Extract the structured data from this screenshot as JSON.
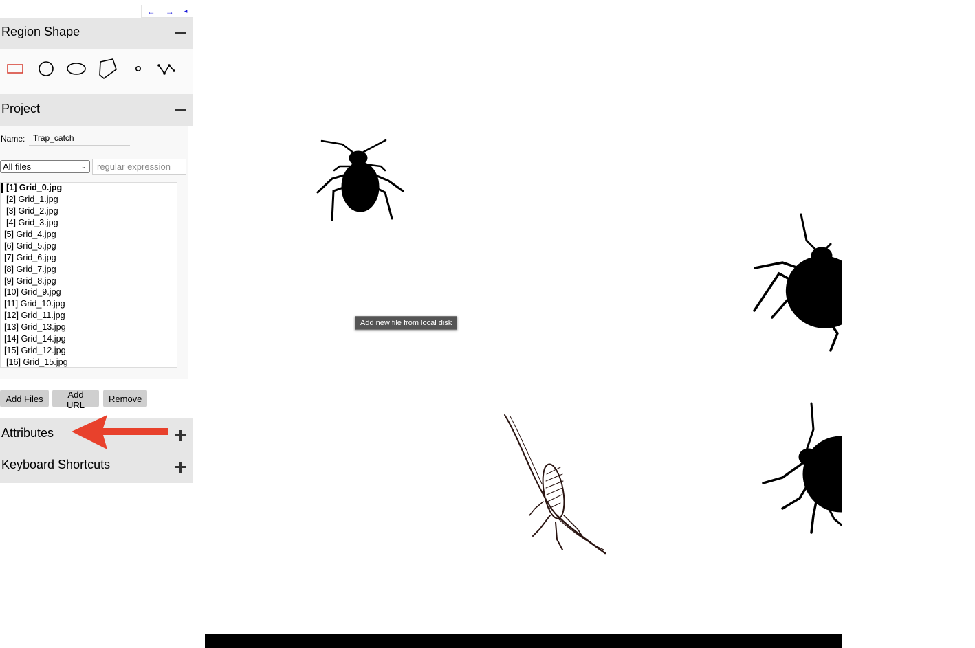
{
  "nav": {
    "prev": "←",
    "next": "→",
    "collapse": "◂"
  },
  "region_shape": {
    "title": "Region Shape",
    "shapes": [
      {
        "name": "rectangle",
        "icon": "rectangle-icon",
        "selected": true
      },
      {
        "name": "circle",
        "icon": "circle-icon"
      },
      {
        "name": "ellipse",
        "icon": "ellipse-icon"
      },
      {
        "name": "polygon",
        "icon": "polygon-icon"
      },
      {
        "name": "point",
        "icon": "point-icon"
      },
      {
        "name": "polyline",
        "icon": "polyline-icon"
      }
    ],
    "selected_color": "#d53a2c"
  },
  "project": {
    "title": "Project",
    "name_label": "Name:",
    "name_value": "Trap_catch",
    "filter_selected": "All files",
    "regex_placeholder": "regular expression",
    "files": [
      "[1] Grid_0.jpg",
      "[2] Grid_1.jpg",
      "[3] Grid_2.jpg",
      "[4] Grid_3.jpg",
      "[5] Grid_4.jpg",
      "[6] Grid_5.jpg",
      "[7] Grid_6.jpg",
      "[8] Grid_7.jpg",
      "[9] Grid_8.jpg",
      "[10] Grid_9.jpg",
      "[11] Grid_10.jpg",
      "[12] Grid_11.jpg",
      "[13] Grid_13.jpg",
      "[14] Grid_14.jpg",
      "[15] Grid_12.jpg",
      "[16] Grid_15.jpg"
    ],
    "active_index": 0,
    "buttons": {
      "add_files": "Add Files",
      "add_url": "Add URL",
      "remove": "Remove"
    }
  },
  "attributes": {
    "title": "Attributes"
  },
  "keyboard_shortcuts": {
    "title": "Keyboard Shortcuts"
  },
  "tooltip": "Add new file from local disk",
  "annotation_arrow_color": "#e8412c"
}
